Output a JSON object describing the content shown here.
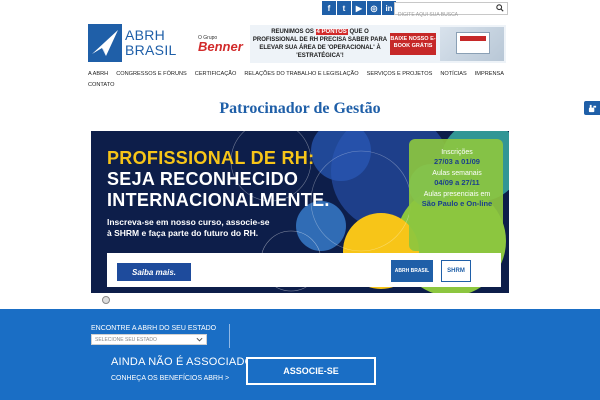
{
  "social": [
    "f",
    "t",
    "▶",
    "◎",
    "in"
  ],
  "search": {
    "placeholder": "DIGITE AQUI SUA BUSCA"
  },
  "logo": {
    "line1": "ABRH",
    "line2": "BRASIL"
  },
  "ad": {
    "group_label": "O Grupo",
    "brand": "Benner",
    "text_before": "REUNIMOS OS",
    "text_highlight": "4 PONTOS",
    "text_after": "QUE O PROFISSIONAL DE RH PRECISA SABER PARA ELEVAR SUA ÁREA DE 'OPERACIONAL' À 'ESTRATÉGICA'!",
    "cta": "BAIXE NOSSO E-BOOK GRÁTIS"
  },
  "nav": [
    "A ABRH",
    "CONGRESSOS E FÓRUNS",
    "CERTIFICAÇÃO",
    "RELAÇÕES DO TRABALHO E LEGISLAÇÃO",
    "SERVIÇOS E PROJETOS",
    "NOTÍCIAS",
    "IMPRENSA",
    "CONTATO"
  ],
  "section_title": "Patrocinador de Gestão",
  "hero": {
    "headline1": "PROFISSIONAL DE RH:",
    "headline2": "SEJA RECONHECIDO",
    "headline3": "INTERNACIONALMENTE.",
    "sub1": "Inscreva-se em nosso curso, associe-se",
    "sub2": "à SHRM e faça parte do futuro do RH.",
    "info": [
      {
        "label": "Inscrições",
        "value": "27/03 a 01/09"
      },
      {
        "label": "Aulas semanais",
        "value": "04/09 a 27/11"
      },
      {
        "label": "Aulas presenciais em",
        "value": "São Paulo e On-line"
      }
    ],
    "cta": "Saiba mais.",
    "logo_abrh": "ABRH BRASIL",
    "logo_shrm": "SHRM"
  },
  "footer": {
    "find_label": "ENCONTRE A ABRH DO SEU ESTADO",
    "select_value": "SELECIONE SEU ESTADO",
    "question": "AINDA NÃO É ASSOCIADO?",
    "benefits_link": "CONHEÇA OS BENEFÍCIOS ABRH >",
    "cta": "ASSOCIE-SE"
  },
  "colors": {
    "brand_blue": "#1f5fa8",
    "footer_blue": "#1a6ec5",
    "hero_yellow": "#f7c518",
    "ad_red": "#c62828"
  }
}
